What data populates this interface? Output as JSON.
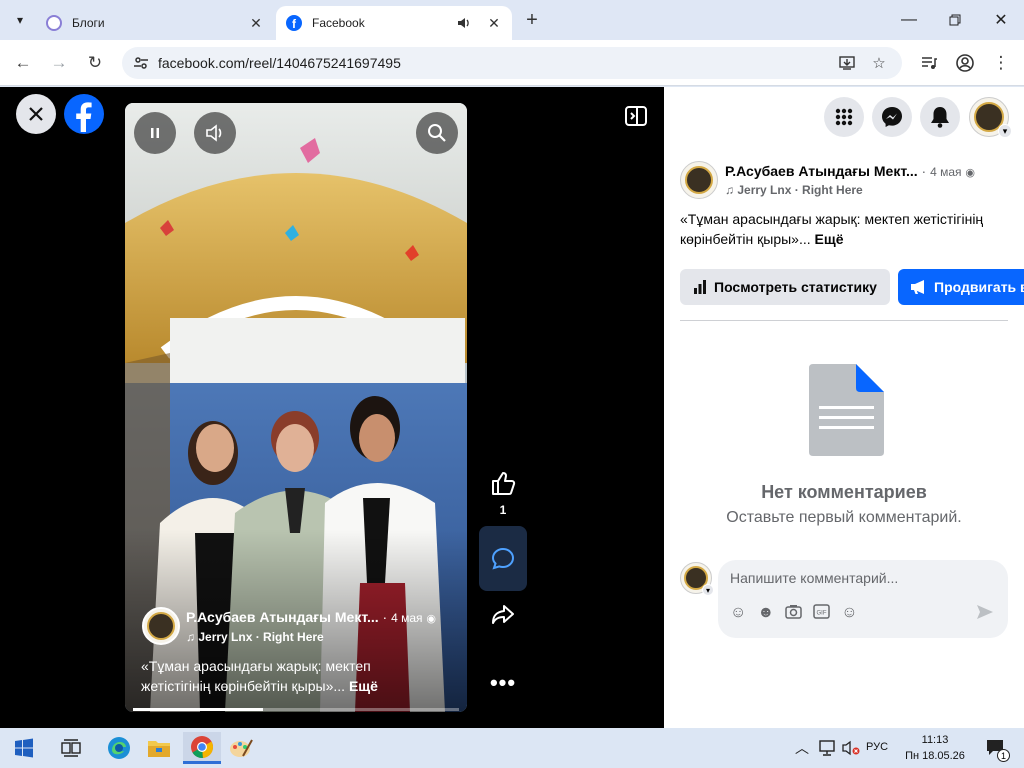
{
  "browser": {
    "tabs": [
      {
        "title": "Блоги",
        "active": false
      },
      {
        "title": "Facebook",
        "active": true
      }
    ],
    "url": "facebook.com/reel/1404675241697495"
  },
  "reel": {
    "author": "Р.Асубаев Атындағы Мект...",
    "time": "4 мая",
    "music": "Jerry Lnx · Right Here",
    "caption": "«Тұман арасындағы жарық: мектеп жетістігінің көрінбейтін қыры»...",
    "more_label": "Ещё",
    "like_count": "1"
  },
  "panel": {
    "author": "Р.Асубаев Атындағы Мект...",
    "time": "4 мая",
    "music": "Jerry Lnx · Right Here",
    "caption": "«Тұман арасындағы жарық: мектеп жетістігінің көрінбейтін қыры»...",
    "more_label": "Ещё",
    "stats_button": "Посмотреть статистику",
    "promote_button": "Продвигать в",
    "no_comments_title": "Нет комментариев",
    "no_comments_subtitle": "Оставьте первый комментарий.",
    "comment_placeholder": "Напишите комментарий..."
  },
  "taskbar": {
    "language": "РУС",
    "time": "11:13",
    "date": "Пн 18.05.26",
    "notification_count": "1"
  },
  "colors": {
    "facebook_blue": "#0866ff",
    "chrome_frame": "#dfe7f5",
    "viewer_bg": "#000000"
  }
}
